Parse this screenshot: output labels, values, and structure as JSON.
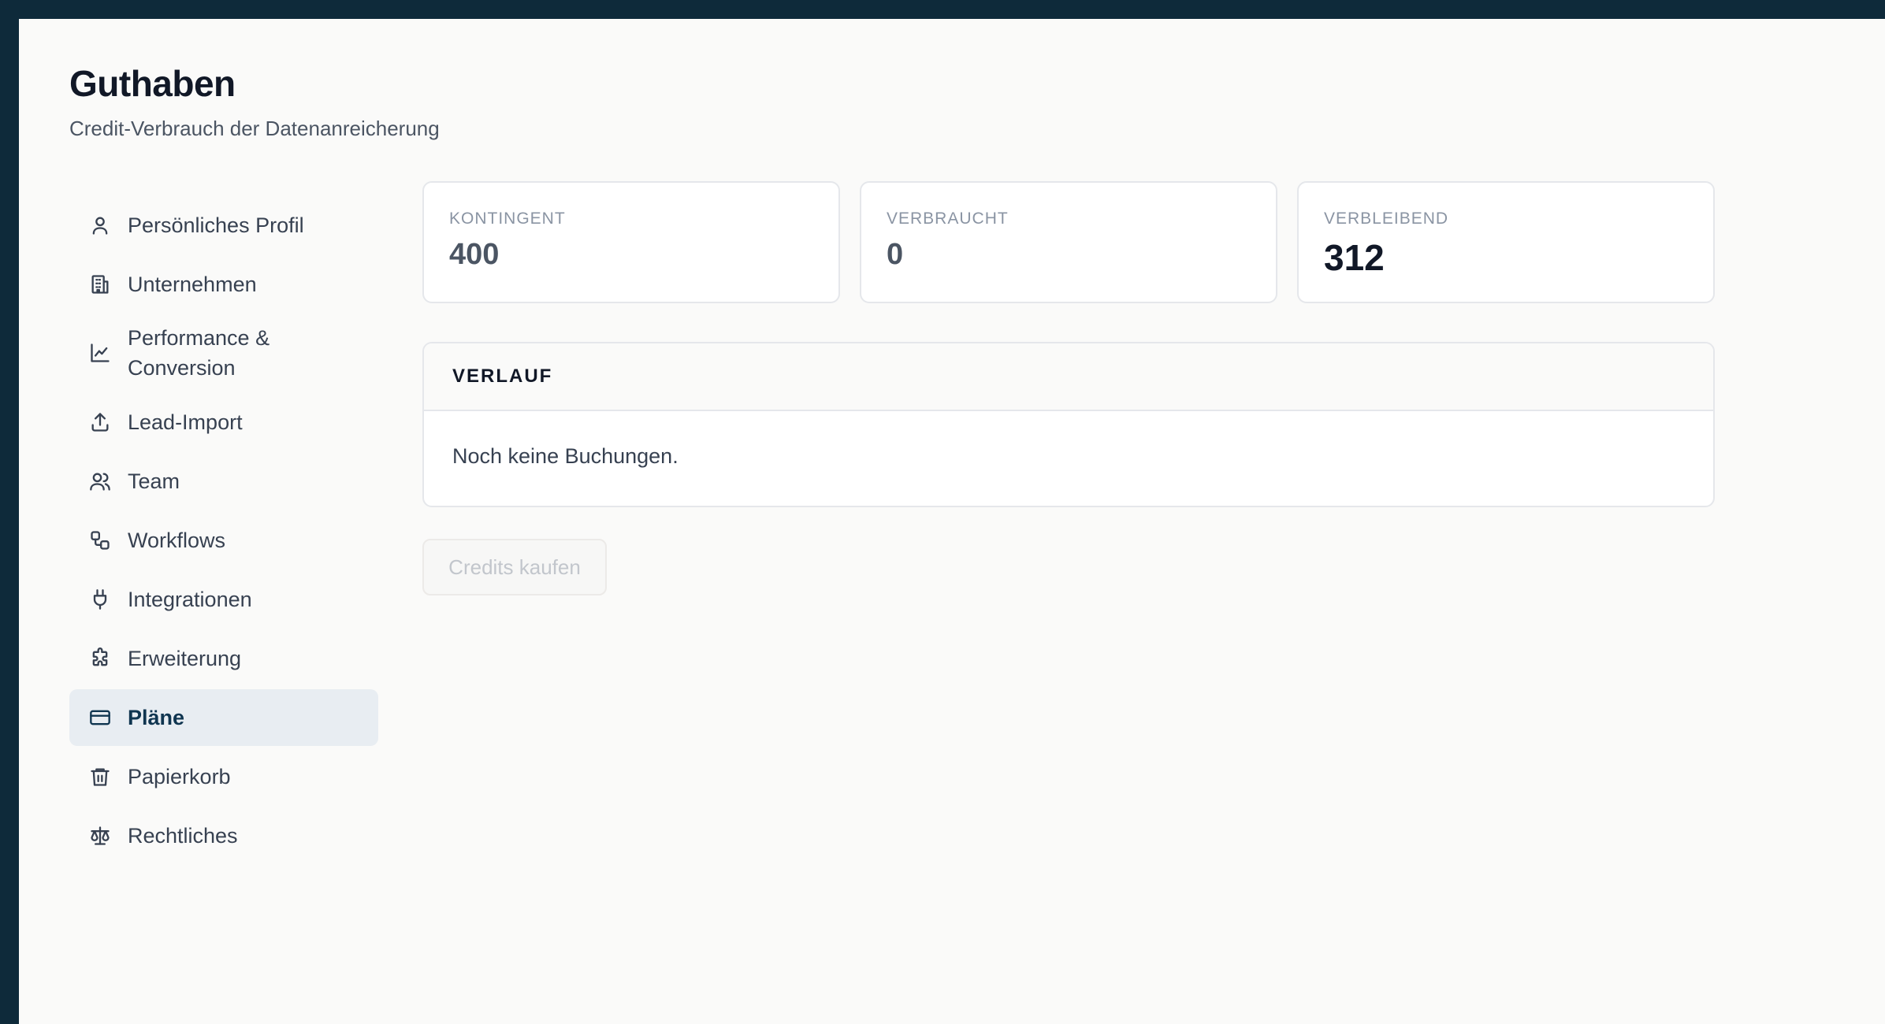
{
  "header": {
    "title": "Guthaben",
    "subtitle": "Credit-Verbrauch der Datenanreicherung"
  },
  "sidebar": {
    "items": [
      {
        "label": "Persönliches Profil",
        "icon": "user-icon"
      },
      {
        "label": "Unternehmen",
        "icon": "building-icon"
      },
      {
        "label": "Performance & Conversion",
        "icon": "chart-line-icon"
      },
      {
        "label": "Lead-Import",
        "icon": "upload-icon"
      },
      {
        "label": "Team",
        "icon": "users-icon"
      },
      {
        "label": "Workflows",
        "icon": "workflow-icon"
      },
      {
        "label": "Integrationen",
        "icon": "plug-icon"
      },
      {
        "label": "Erweiterung",
        "icon": "puzzle-icon"
      },
      {
        "label": "Pläne",
        "icon": "credit-card-icon",
        "active": true
      },
      {
        "label": "Papierkorb",
        "icon": "trash-icon"
      },
      {
        "label": "Rechtliches",
        "icon": "scale-icon"
      }
    ]
  },
  "stats": {
    "quota": {
      "label": "KONTINGENT",
      "value": "400"
    },
    "used": {
      "label": "VERBRAUCHT",
      "value": "0"
    },
    "remaining": {
      "label": "VERBLEIBEND",
      "value": "312"
    }
  },
  "history": {
    "title": "VERLAUF",
    "empty_text": "Noch keine Buchungen."
  },
  "actions": {
    "buy_label": "Credits kaufen",
    "buy_enabled": false
  },
  "colors": {
    "frame": "#0e2a3a",
    "page_bg": "#fafaf9",
    "active_nav_bg": "#e8edf2",
    "active_nav_text": "#0f3550",
    "card_border": "#e5e7eb"
  }
}
